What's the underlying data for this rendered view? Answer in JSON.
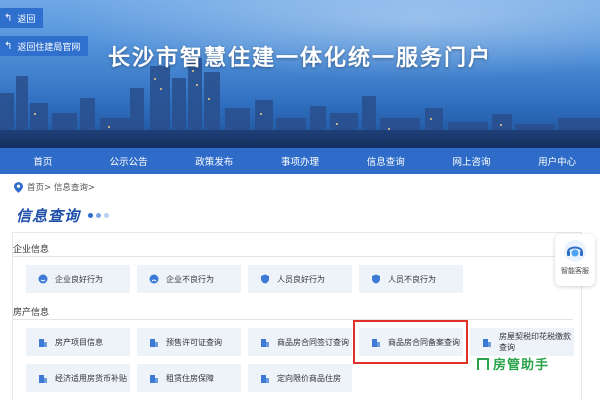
{
  "header": {
    "back_label": "返回",
    "back_ministry_label": "返回住建局官网",
    "portal_title": "长沙市智慧住建一体化统一服务门户"
  },
  "nav": {
    "items": [
      "首页",
      "公示公告",
      "政策发布",
      "事项办理",
      "信息查询",
      "网上咨询",
      "用户中心"
    ]
  },
  "breadcrumb": {
    "text": "首页> 信息查询>"
  },
  "section": {
    "title": "信息查询"
  },
  "groups": {
    "enterprise": {
      "label": "企业信息",
      "cards": [
        "企业良好行为",
        "企业不良行为",
        "人员良好行为",
        "人员不良行为"
      ]
    },
    "property": {
      "label": "房产信息",
      "cards": [
        "房产项目信息",
        "预售许可证查询",
        "商品房合同签订查询",
        "商品房合同备案查询",
        "房屋契税印花税缴款查询",
        "经济适用房货币补贴",
        "租赁住房保障",
        "定向限价商品住房"
      ]
    }
  },
  "service": {
    "label": "智能客服"
  },
  "watermark": {
    "text": "房管助手"
  },
  "colors": {
    "nav": "#2f6cc9",
    "title_blue": "#1f4fa8",
    "card_bg": "#eef3fa",
    "highlight": "#e0322a",
    "watermark": "#2aa34a"
  }
}
